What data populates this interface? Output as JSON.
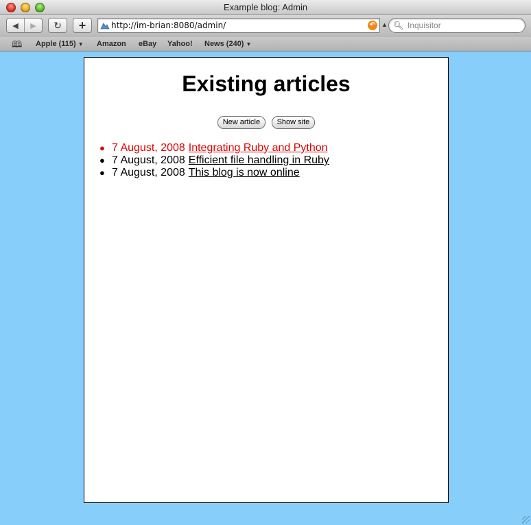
{
  "window": {
    "title": "Example blog: Admin"
  },
  "toolbar": {
    "back_icon": "◀",
    "forward_icon": "▶",
    "reload_icon": "↻",
    "add_icon": "+",
    "url": "http://im-brian:8080/admin/",
    "search_placeholder": "Inquisitor"
  },
  "bookmarks": {
    "items": [
      {
        "label": "Apple (115)",
        "has_menu": true
      },
      {
        "label": "Amazon",
        "has_menu": false
      },
      {
        "label": "eBay",
        "has_menu": false
      },
      {
        "label": "Yahoo!",
        "has_menu": false
      },
      {
        "label": "News (240)",
        "has_menu": true
      }
    ],
    "menu_arrow": "▼"
  },
  "page": {
    "heading": "Existing articles",
    "new_article_label": "New article",
    "show_site_label": "Show site",
    "articles": [
      {
        "date": "7 August, 2008",
        "title": "Integrating Ruby and Python",
        "highlighted": true
      },
      {
        "date": "7 August, 2008",
        "title": "Efficient file handling in Ruby",
        "highlighted": false
      },
      {
        "date": "7 August, 2008",
        "title": "This blog is now online",
        "highlighted": false
      }
    ]
  },
  "colors": {
    "desktop_background": "#87cefa",
    "highlight": "#e00000"
  }
}
